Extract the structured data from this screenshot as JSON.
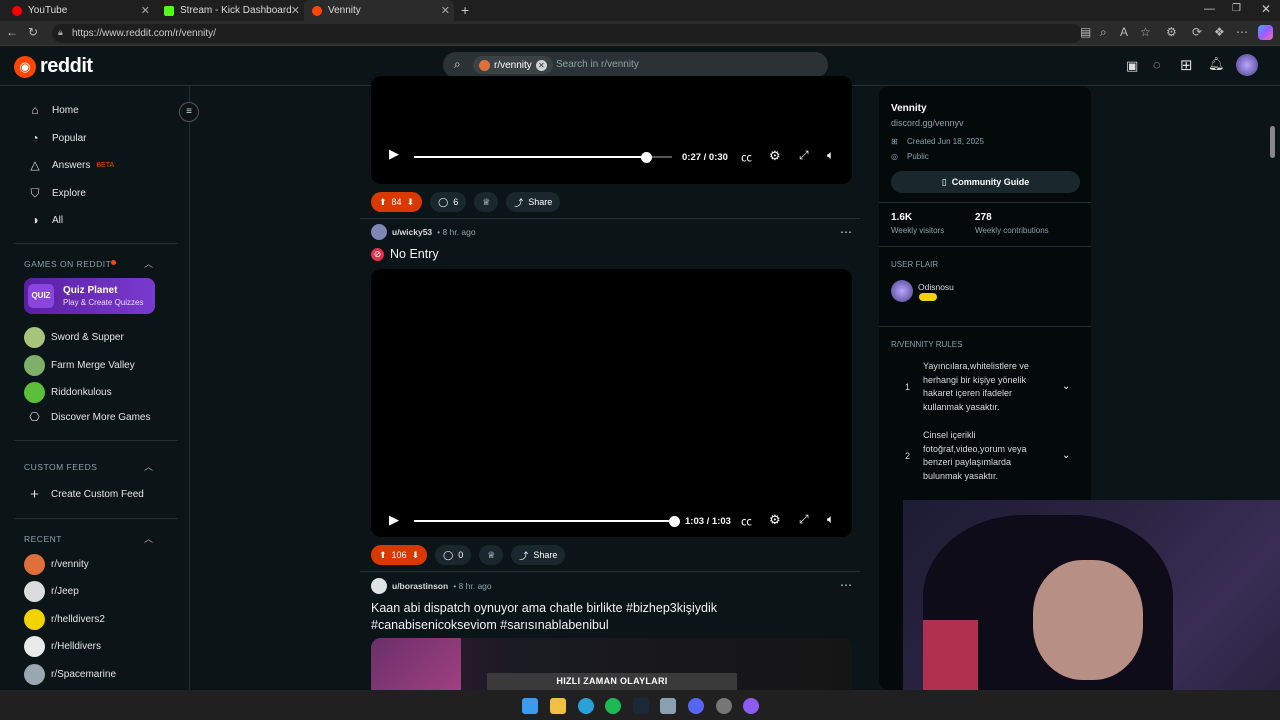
{
  "browser": {
    "tabs": [
      {
        "label": "YouTube",
        "color": "#ff0000"
      },
      {
        "label": "Stream - Kick Dashboard",
        "color": "#53fc18"
      },
      {
        "label": "Vennity",
        "color": "#ff4500"
      }
    ],
    "url": "https://www.reddit.com/r/vennity/"
  },
  "header": {
    "logo": "reddit",
    "search_chip": "r/vennity",
    "search_placeholder": "Search in r/vennity"
  },
  "sidebar": {
    "nav": [
      {
        "label": "Home",
        "icon": "home-icon"
      },
      {
        "label": "Popular",
        "icon": "popular-icon"
      },
      {
        "label": "Answers",
        "icon": "answers-icon",
        "badge": "BETA"
      },
      {
        "label": "Explore",
        "icon": "explore-icon"
      },
      {
        "label": "All",
        "icon": "all-icon"
      }
    ],
    "games_heading": "GAMES ON REDDIT",
    "quiz_title": "Quiz Planet",
    "quiz_sub": "Play & Create Quizzes",
    "quiz_logo": "QUIZ",
    "games": [
      "Sword & Supper",
      "Farm Merge Valley",
      "Riddonkulous",
      "Discover More Games"
    ],
    "custom_heading": "CUSTOM FEEDS",
    "create_feed": "Create Custom Feed",
    "recent_heading": "RECENT",
    "recent": [
      "r/vennity",
      "r/Jeep",
      "r/helldivers2",
      "r/Helldivers",
      "r/Spacemarine"
    ]
  },
  "posts": [
    {
      "time": "0:27 / 0:30",
      "progress": 0.9,
      "votes": "84",
      "comments": "6",
      "share": "Share"
    },
    {
      "user": "u/wicky53",
      "ago": "• 8 hr. ago",
      "title": "No Entry",
      "time": "1:03 / 1:03",
      "progress": 1.0,
      "votes": "106",
      "comments": "0",
      "share": "Share"
    },
    {
      "user": "u/borastinson",
      "ago": "• 8 hr. ago",
      "title": "Kaan abi dispatch oynuyor ama chatle birlikte #bizhep3kişiydik #canabisenicokseviom #sarısınablabenibul"
    }
  ],
  "community": {
    "name": "Vennity",
    "desc": "discord.gg/vennyv",
    "created": "Created Jun 18, 2025",
    "visibility": "Public",
    "guide": "Community Guide",
    "visitors": "1.6K",
    "visitors_label": "Weekly visitors",
    "contrib": "278",
    "contrib_label": "Weekly contributions",
    "flair_heading": "USER FLAIR",
    "flair_user": "Odisnosu",
    "rules_heading": "R/VENNITY RULES",
    "rules": [
      {
        "num": "1",
        "text": "Yayıncılara,whitelistlere ve herhangi bir kişiye yönelik hakaret içeren ifadeler kullanmak yasaktır."
      },
      {
        "num": "2",
        "text": "Cinsel içerikli fotoğraf,video,yorum veya benzeri paylaşımlarda bulunmak yasaktır."
      }
    ]
  },
  "overlay": {
    "banner": "HIZLI ZAMAN OLAYLARI"
  }
}
